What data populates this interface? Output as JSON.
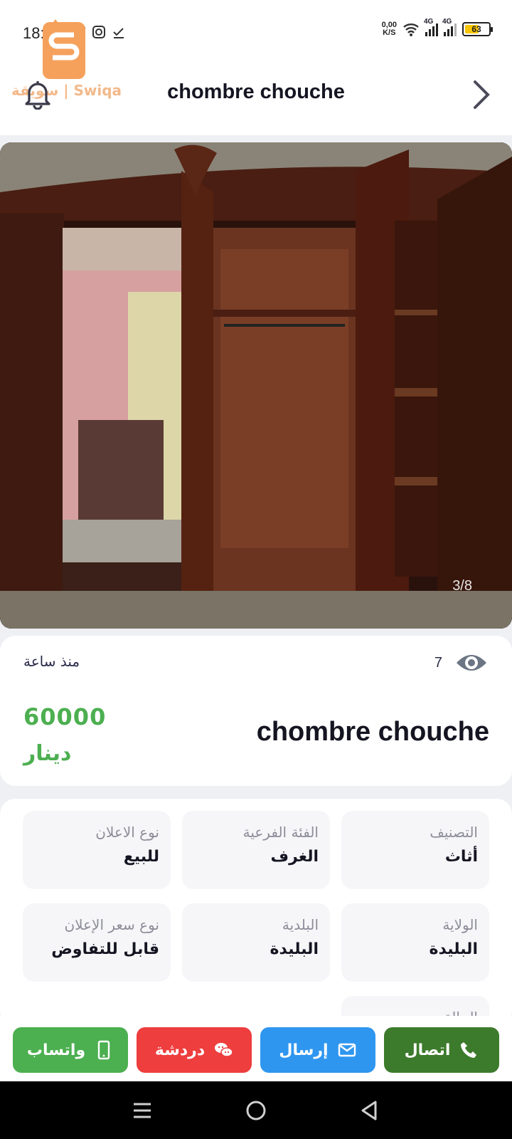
{
  "status_bar": {
    "time": "18:55",
    "net_speed_value": "0,00",
    "net_speed_unit": "K/S",
    "network_1": "4G",
    "network_2": "4G",
    "battery": "63",
    "battery_level": 0.63
  },
  "header": {
    "logo_text": "سويقة | Swiqa",
    "title": "chombre chouche"
  },
  "photo": {
    "counter": "3/8"
  },
  "info": {
    "views": "7",
    "time_ago": "منذ ساعة",
    "price": "60000",
    "currency": "دينار",
    "title": "chombre chouche"
  },
  "attributes": [
    {
      "label": "التصنيف",
      "value": "أثاث"
    },
    {
      "label": "الفئة الفرعية",
      "value": "الغرف"
    },
    {
      "label": "نوع الاعلان",
      "value": "للبيع"
    },
    {
      "label": "الولاية",
      "value": "البليدة"
    },
    {
      "label": "البلدية",
      "value": "البليدة"
    },
    {
      "label": "نوع سعر الإعلان",
      "value": "قابل للتفاوض"
    },
    {
      "label": "الحالة",
      "value": ""
    }
  ],
  "actions": {
    "call": "اتصال",
    "send": "إرسال",
    "chat": "دردشة",
    "whatsapp": "واتساب"
  },
  "colors": {
    "price_green": "#4caf50",
    "call_green": "#3d7b2c",
    "send_blue": "#2f96f0",
    "chat_red": "#ee3e3e",
    "whatsapp_green": "#4caf50",
    "logo_orange": "#f5a15c"
  },
  "icons": {
    "bell": "bell-icon",
    "back": "chevron-right-icon",
    "views": "eye-icon",
    "call": "phone-icon",
    "send": "mail-icon",
    "chat": "chat-bubbles-icon",
    "whatsapp": "mobile-phone-icon"
  }
}
